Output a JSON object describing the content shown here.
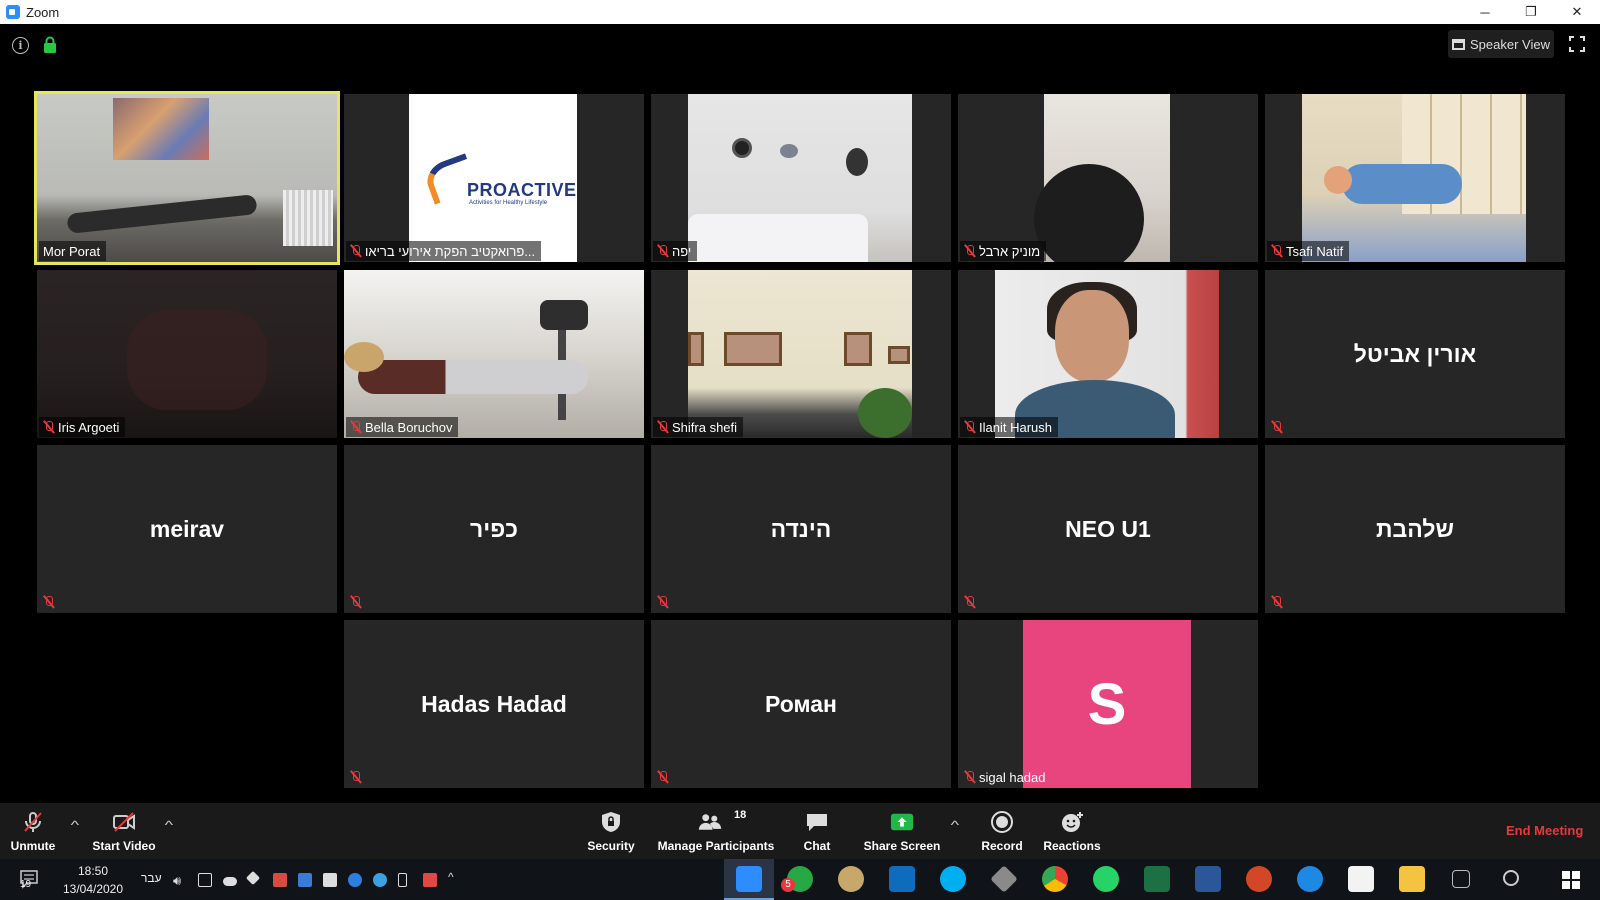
{
  "window": {
    "title": "Zoom",
    "controls": [
      "─",
      "❐",
      "✕"
    ]
  },
  "top_bar": {
    "speaker_view_label": "Speaker View"
  },
  "tiles": [
    {
      "name": "Mor Porat",
      "muted": false,
      "active": true
    },
    {
      "name": "פרואקטיב הפקת אירועי בריאו...",
      "muted": true
    },
    {
      "name": "יפה",
      "muted": true
    },
    {
      "name": "מוניק ארבל",
      "muted": true
    },
    {
      "name": "Tsafi Natif",
      "muted": true
    },
    {
      "name": "Iris Argoeti",
      "muted": true
    },
    {
      "name": "Bella Boruchov",
      "muted": true
    },
    {
      "name": "Shifra shefi",
      "muted": true
    },
    {
      "name": "Ilanit Harush",
      "muted": true
    },
    {
      "name": "אורין אביטל",
      "muted": true
    },
    {
      "name": "meirav",
      "muted": true
    },
    {
      "name": "כפיר",
      "muted": true
    },
    {
      "name": "הינדה",
      "muted": true
    },
    {
      "name": "NEO U1",
      "muted": true
    },
    {
      "name": "שלהבת",
      "muted": true
    },
    {
      "name": "Hadas Hadad",
      "muted": true
    },
    {
      "name": "Роман",
      "muted": true
    },
    {
      "name": "sigal hadad",
      "muted": true,
      "avatar_letter": "S"
    }
  ],
  "logo": {
    "text": "PROACTIVE",
    "subtext": "Activities for Healthy Lifestyle"
  },
  "toolbar": {
    "unmute": "Unmute",
    "start_video": "Start Video",
    "security": "Security",
    "manage_participants": "Manage Participants",
    "participant_count": "18",
    "chat": "Chat",
    "share_screen": "Share Screen",
    "record": "Record",
    "reactions": "Reactions",
    "end_meeting": "End Meeting"
  },
  "taskbar": {
    "time": "18:50",
    "date": "13/04/2020",
    "language": "עבר",
    "notification_count": "19",
    "badge": "5"
  },
  "colors": {
    "active_speaker_border": "#e7e55a",
    "tile_bg": "#262626",
    "muted_red": "#e8383d",
    "avatar_pink": "#e8457e",
    "end_meeting_red": "#e8383d",
    "share_green": "#20b846"
  }
}
